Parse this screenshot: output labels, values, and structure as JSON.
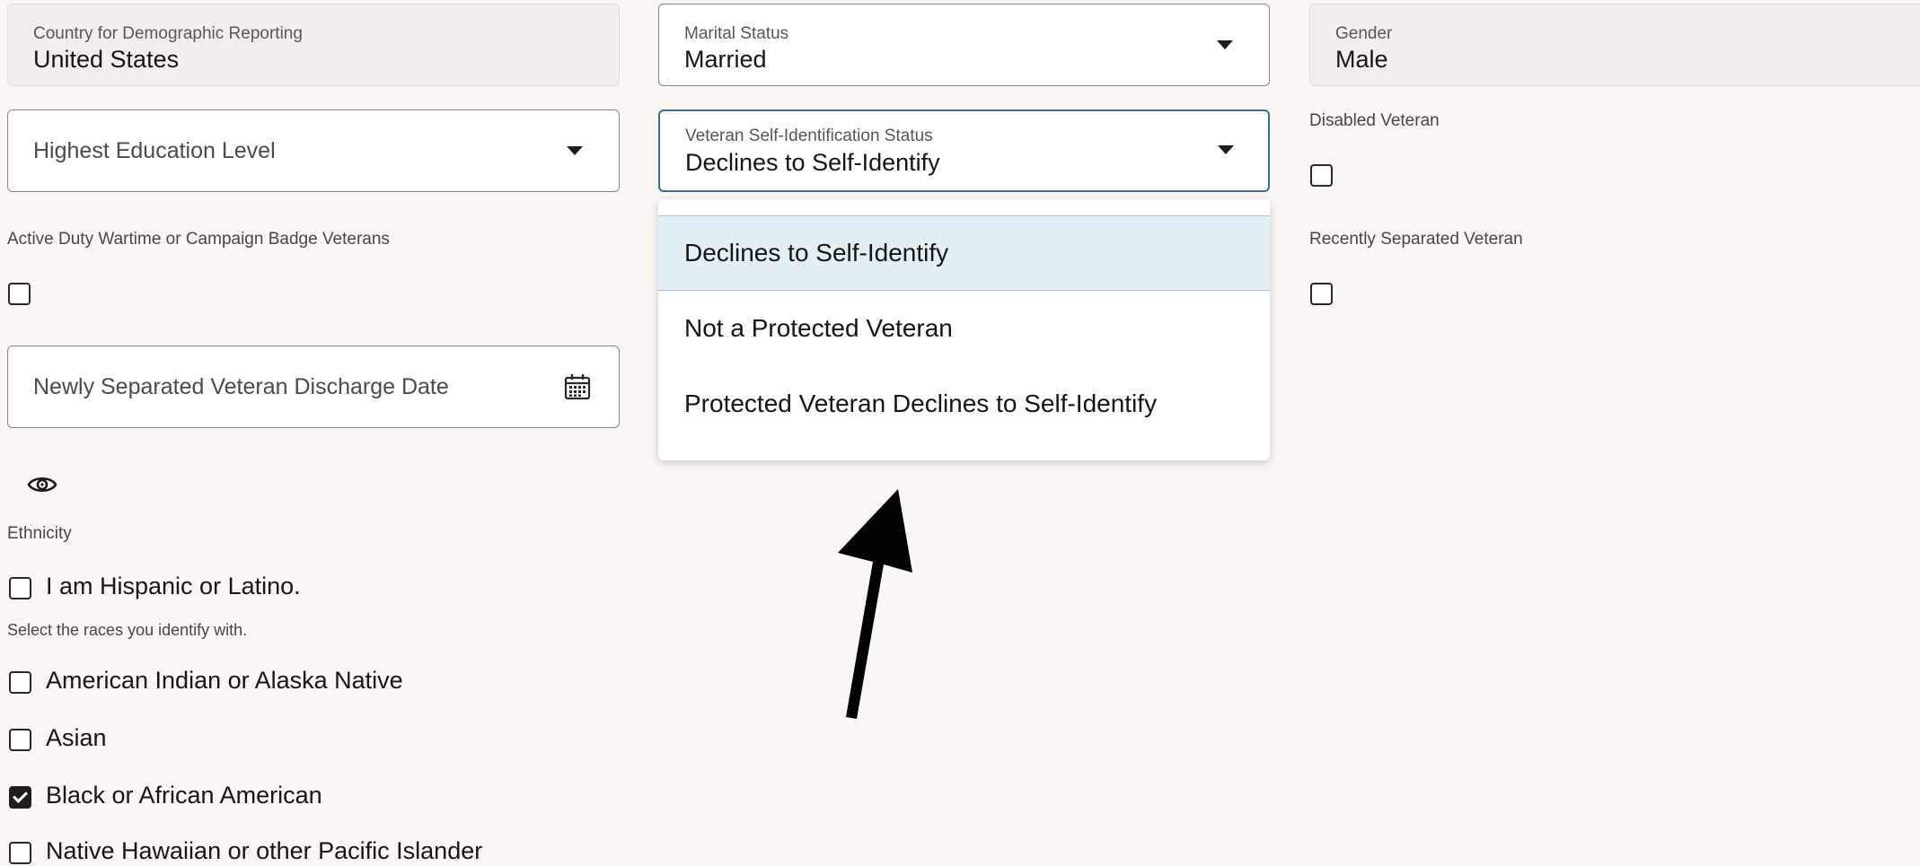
{
  "country": {
    "label": "Country for Demographic Reporting",
    "value": "United States"
  },
  "marital": {
    "label": "Marital Status",
    "value": "Married"
  },
  "gender": {
    "label": "Gender",
    "value": "Male"
  },
  "education": {
    "placeholder": "Highest Education Level"
  },
  "veteran_status": {
    "label": "Veteran Self-Identification Status",
    "value": "Declines to Self-Identify",
    "options": [
      "Declines to Self-Identify",
      "Not a Protected Veteran",
      "Protected Veteran Declines to Self-Identify"
    ],
    "selected_index": 0
  },
  "disabled_veteran": {
    "label": "Disabled Veteran",
    "checked": false
  },
  "active_duty": {
    "label": "Active Duty Wartime or Campaign Badge Veterans",
    "checked": false
  },
  "recently_separated": {
    "label": "Recently Separated Veteran",
    "checked": false
  },
  "discharge_date": {
    "placeholder": "Newly Separated Veteran Discharge Date"
  },
  "ethnicity": {
    "label": "Ethnicity",
    "hispanic": {
      "label": "I am Hispanic or Latino.",
      "checked": false
    }
  },
  "races": {
    "prompt": "Select the races you identify with.",
    "options": [
      {
        "label": "American Indian or Alaska Native",
        "checked": false
      },
      {
        "label": "Asian",
        "checked": false
      },
      {
        "label": "Black or African American",
        "checked": true
      },
      {
        "label": "Native Hawaiian or other Pacific Islander",
        "checked": false
      }
    ]
  },
  "icons": {
    "calendar": "calendar-icon",
    "eye": "eye-icon",
    "caret": "caret-down-icon",
    "arrow": "annotation-arrow"
  }
}
